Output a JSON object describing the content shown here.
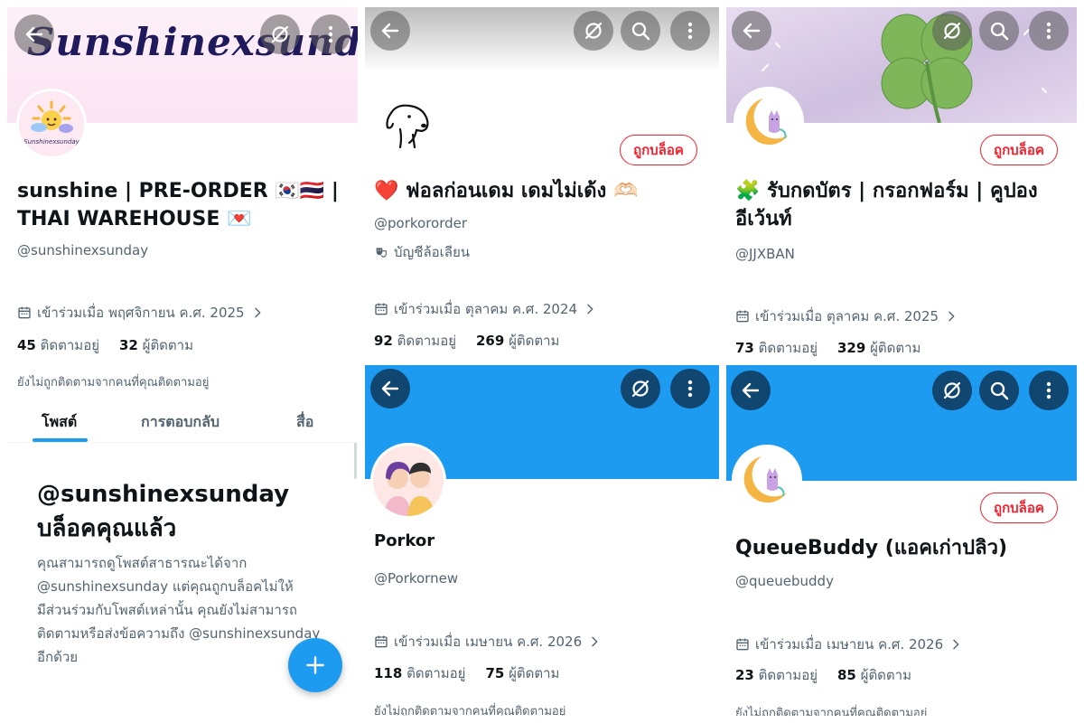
{
  "colors": {
    "accent_blue": "#1d9bf0",
    "block_red": "#f4212e",
    "text_secondary": "#536471",
    "text_primary": "#0f1419",
    "banner_blue": "#1d9bf0"
  },
  "icons": [
    "back-arrow-icon",
    "link-off-icon",
    "search-icon",
    "more-vertical-icon",
    "calendar-icon",
    "chevron-right-icon",
    "plus-icon"
  ],
  "panel1": {
    "banner_text": "Sunshinexsunday",
    "avatar_caption": "Sunshinexsunday",
    "name_line1": "sunshine | PRE-ORDER 🇰🇷🇹🇭 |",
    "name_line2": "THAI WAREHOUSE 💌",
    "handle": "@sunshinexsunday",
    "joined": "เข้าร่วมเมื่อ พฤศจิกายน ค.ศ. 2025",
    "following_count": "45",
    "following_label": "ติดตามอยู่",
    "followers_count": "32",
    "followers_label": "ผู้ติดตาม",
    "not_followed_note": "ยังไม่ถูกติดตามจากคนที่คุณติดตามอยู่",
    "tabs": [
      "โพสต์",
      "การตอบกลับ",
      "สื่อ"
    ],
    "blocked_title_line1": "@sunshinexsunday",
    "blocked_title_line2": "บล็อคคุณแล้ว",
    "blocked_body": [
      "คุณสามารถดูโพสต์สาธารณะได้จาก",
      "@sunshinexsunday แต่คุณถูกบล็อคไม่ให้",
      "มีส่วนร่วมกับโพสต์เหล่านั้น คุณยังไม่สามารถ",
      "ติดตามหรือส่งข้อความถึง @sunshinexsunday",
      "อีกด้วย"
    ]
  },
  "panel2": {
    "block_label": "ถูกบล็อค",
    "name": "❤️ ฟอลก่อนเดม เดมไม่เด้ง 🫶🏻",
    "handle": "@porkororder",
    "parody_label": "บัญชีล้อเลียน",
    "joined": "เข้าร่วมเมื่อ ตุลาคม ค.ศ. 2024",
    "following_count": "92",
    "following_label": "ติดตามอยู่",
    "followers_count": "269",
    "followers_label": "ผู้ติดตาม"
  },
  "panel3": {
    "block_label": "ถูกบล็อค",
    "name_line1": "🧩 รับกดบัตร | กรอกฟอร์ม | คูปอง",
    "name_line2": "อีเว้นท์",
    "handle": "@JJXBAN",
    "joined": "เข้าร่วมเมื่อ ตุลาคม ค.ศ. 2025",
    "following_count": "73",
    "following_label": "ติดตามอยู่",
    "followers_count": "329",
    "followers_label": "ผู้ติดตาม"
  },
  "panel4": {
    "name": "Porkor",
    "handle": "@Porkornew",
    "joined": "เข้าร่วมเมื่อ เมษายน ค.ศ. 2026",
    "following_count": "118",
    "following_label": "ติดตามอยู่",
    "followers_count": "75",
    "followers_label": "ผู้ติดตาม",
    "not_followed_note": "ยังไม่ถูกติดตามจากคนที่คุณติดตามอยู่"
  },
  "panel5": {
    "block_label": "ถูกบล็อค",
    "name": "QueueBuddy (แอคเก่าปลิว)",
    "handle": "@queuebuddy",
    "joined": "เข้าร่วมเมื่อ เมษายน ค.ศ. 2026",
    "following_count": "23",
    "following_label": "ติดตามอยู่",
    "followers_count": "85",
    "followers_label": "ผู้ติดตาม",
    "not_followed_note": "ยังไม่ถูกติดตามจากคนที่คุณติดตามอยู่"
  }
}
